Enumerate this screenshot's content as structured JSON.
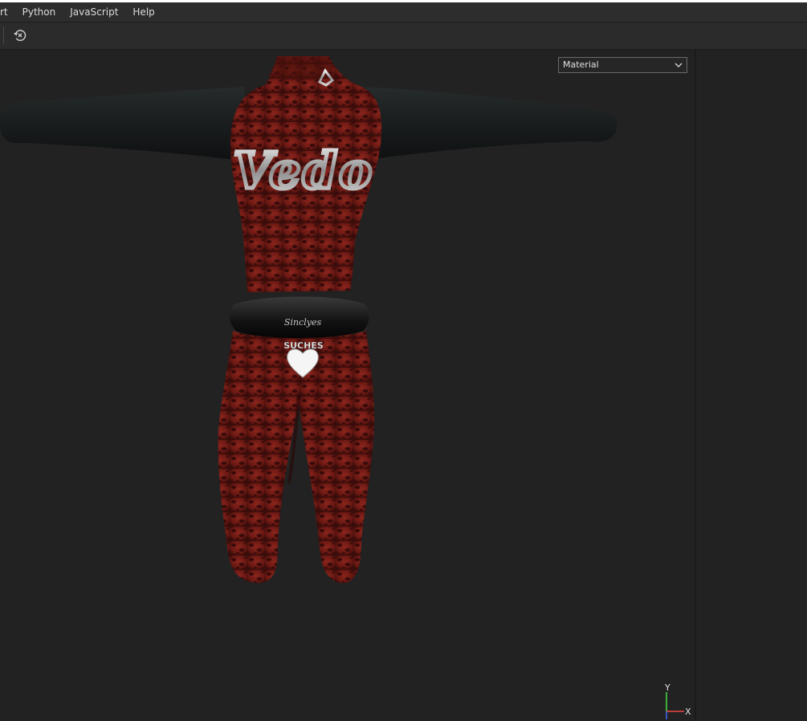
{
  "menubar": {
    "items": [
      {
        "label": "rt"
      },
      {
        "label": "Python"
      },
      {
        "label": "JavaScript"
      },
      {
        "label": "Help"
      }
    ]
  },
  "toolbar": {
    "reset_icon": "reset-view-icon"
  },
  "viewport": {
    "shading_mode": "Material",
    "model": {
      "chest_text": "Vedo",
      "waistband_text": "Sinclyes",
      "charm_text": "SUCHES"
    },
    "gizmo": {
      "y_label": "Y",
      "x_label": "X",
      "y_color": "#44dd44",
      "x_color": "#ee4444",
      "z_color": "#4466ff"
    }
  },
  "colors": {
    "accent_fabric": "#7a1d17",
    "sleeve": "#16191a",
    "background": "#222222"
  }
}
